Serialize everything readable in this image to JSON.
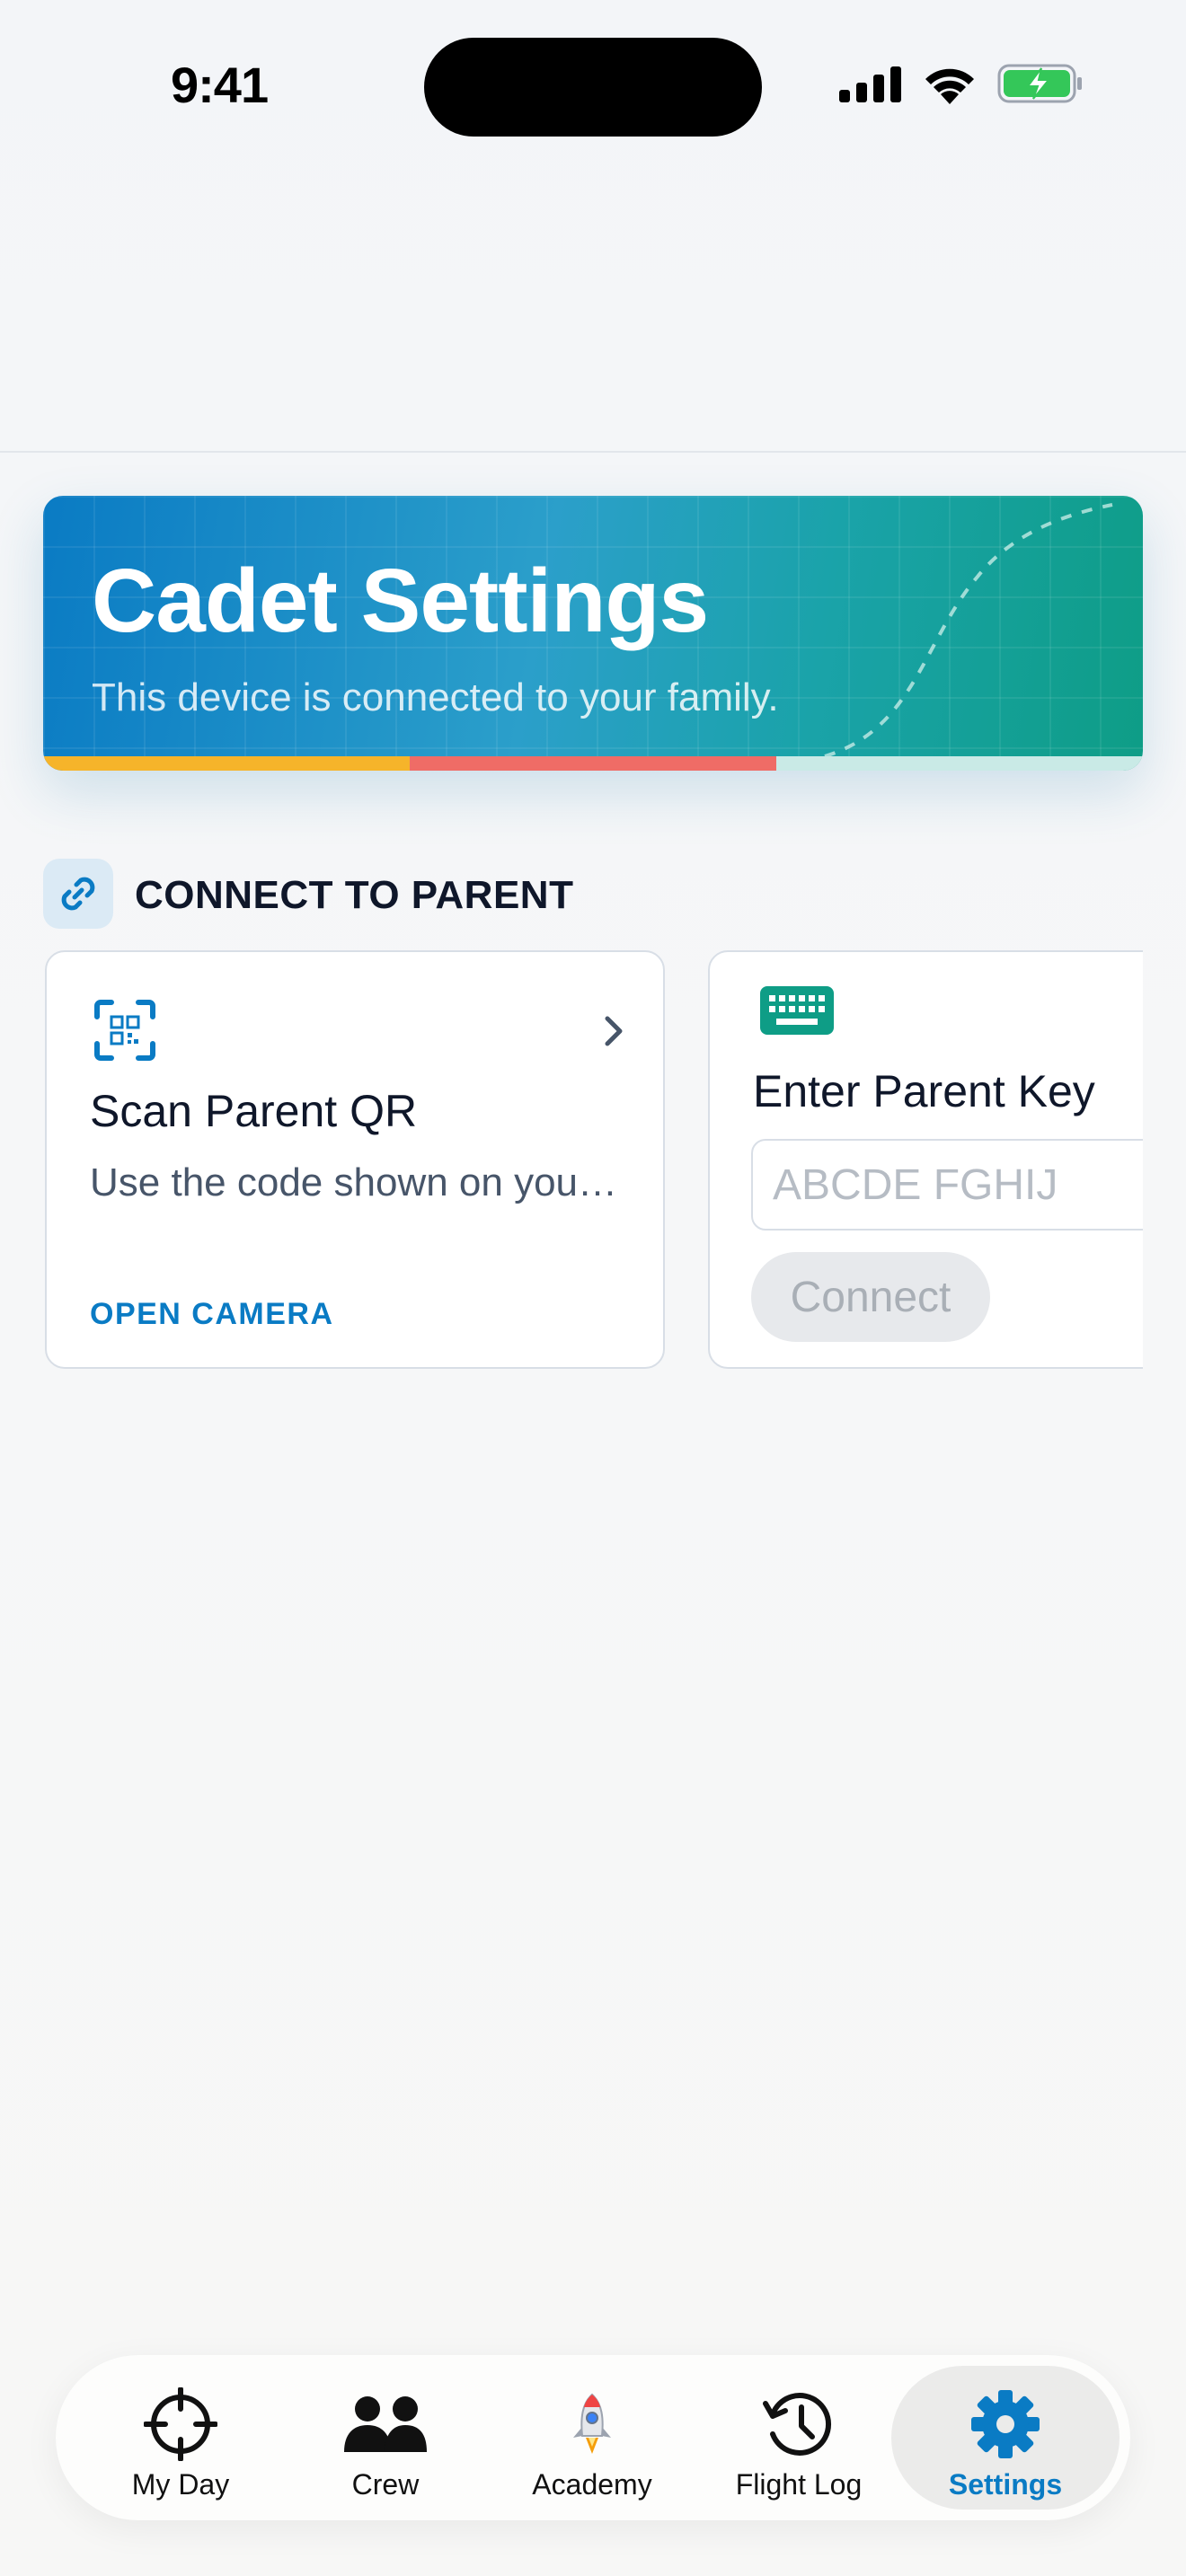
{
  "status_bar": {
    "time": "9:41"
  },
  "hero": {
    "title": "Cadet Settings",
    "subtitle": "This device is connected to your family.",
    "stripe_colors": [
      "#f6b42a",
      "#ef6c66",
      "#c9eae6"
    ]
  },
  "section": {
    "title": "CONNECT TO PARENT",
    "icon": "link-icon"
  },
  "scan_card": {
    "icon": "qr-scan-icon",
    "title": "Scan Parent QR",
    "description": "Use the code shown on your parent's device",
    "action_label": "OPEN CAMERA"
  },
  "key_card": {
    "icon": "keyboard-icon",
    "title": "Enter Parent Key",
    "input_value": "",
    "input_placeholder": "ABCDE FGHIJ",
    "button_label": "Connect"
  },
  "tab_bar": {
    "items": [
      {
        "label": "My Day",
        "icon": "crosshair-icon"
      },
      {
        "label": "Crew",
        "icon": "people-icon"
      },
      {
        "label": "Academy",
        "icon": "rocket-icon"
      },
      {
        "label": "Flight Log",
        "icon": "history-icon"
      },
      {
        "label": "Settings",
        "icon": "gear-icon"
      }
    ],
    "active": "Settings"
  },
  "colors": {
    "accent": "#0a7bc4",
    "teal": "#0e9d86"
  }
}
